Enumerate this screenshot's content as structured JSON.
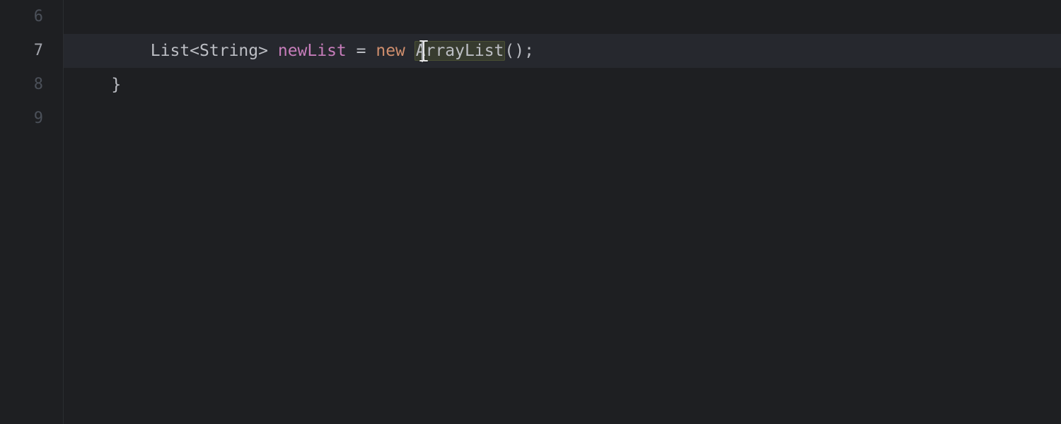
{
  "gutter": {
    "lines": [
      "6",
      "7",
      "8",
      "9"
    ],
    "activeLine": 1
  },
  "code": {
    "lines": [
      {
        "indent": "",
        "tokens": []
      },
      {
        "indent": "        ",
        "tokens": [
          {
            "text": "List",
            "class": "token-type"
          },
          {
            "text": "<",
            "class": "token-punct"
          },
          {
            "text": "String",
            "class": "token-generic"
          },
          {
            "text": ">",
            "class": "token-punct"
          },
          {
            "text": " ",
            "class": ""
          },
          {
            "text": "newList",
            "class": "token-identifier"
          },
          {
            "text": " ",
            "class": ""
          },
          {
            "text": "=",
            "class": "token-operator"
          },
          {
            "text": " ",
            "class": ""
          },
          {
            "text": "new",
            "class": "token-keyword"
          },
          {
            "text": " ",
            "class": ""
          },
          {
            "text": "ArrayList",
            "class": "token-class highlight-box"
          },
          {
            "text": "()",
            "class": "token-punct"
          },
          {
            "text": ";",
            "class": "token-punct"
          }
        ],
        "active": true
      },
      {
        "indent": "    ",
        "tokens": [
          {
            "text": "}",
            "class": "token-brace"
          }
        ]
      },
      {
        "indent": "",
        "tokens": []
      }
    ]
  }
}
